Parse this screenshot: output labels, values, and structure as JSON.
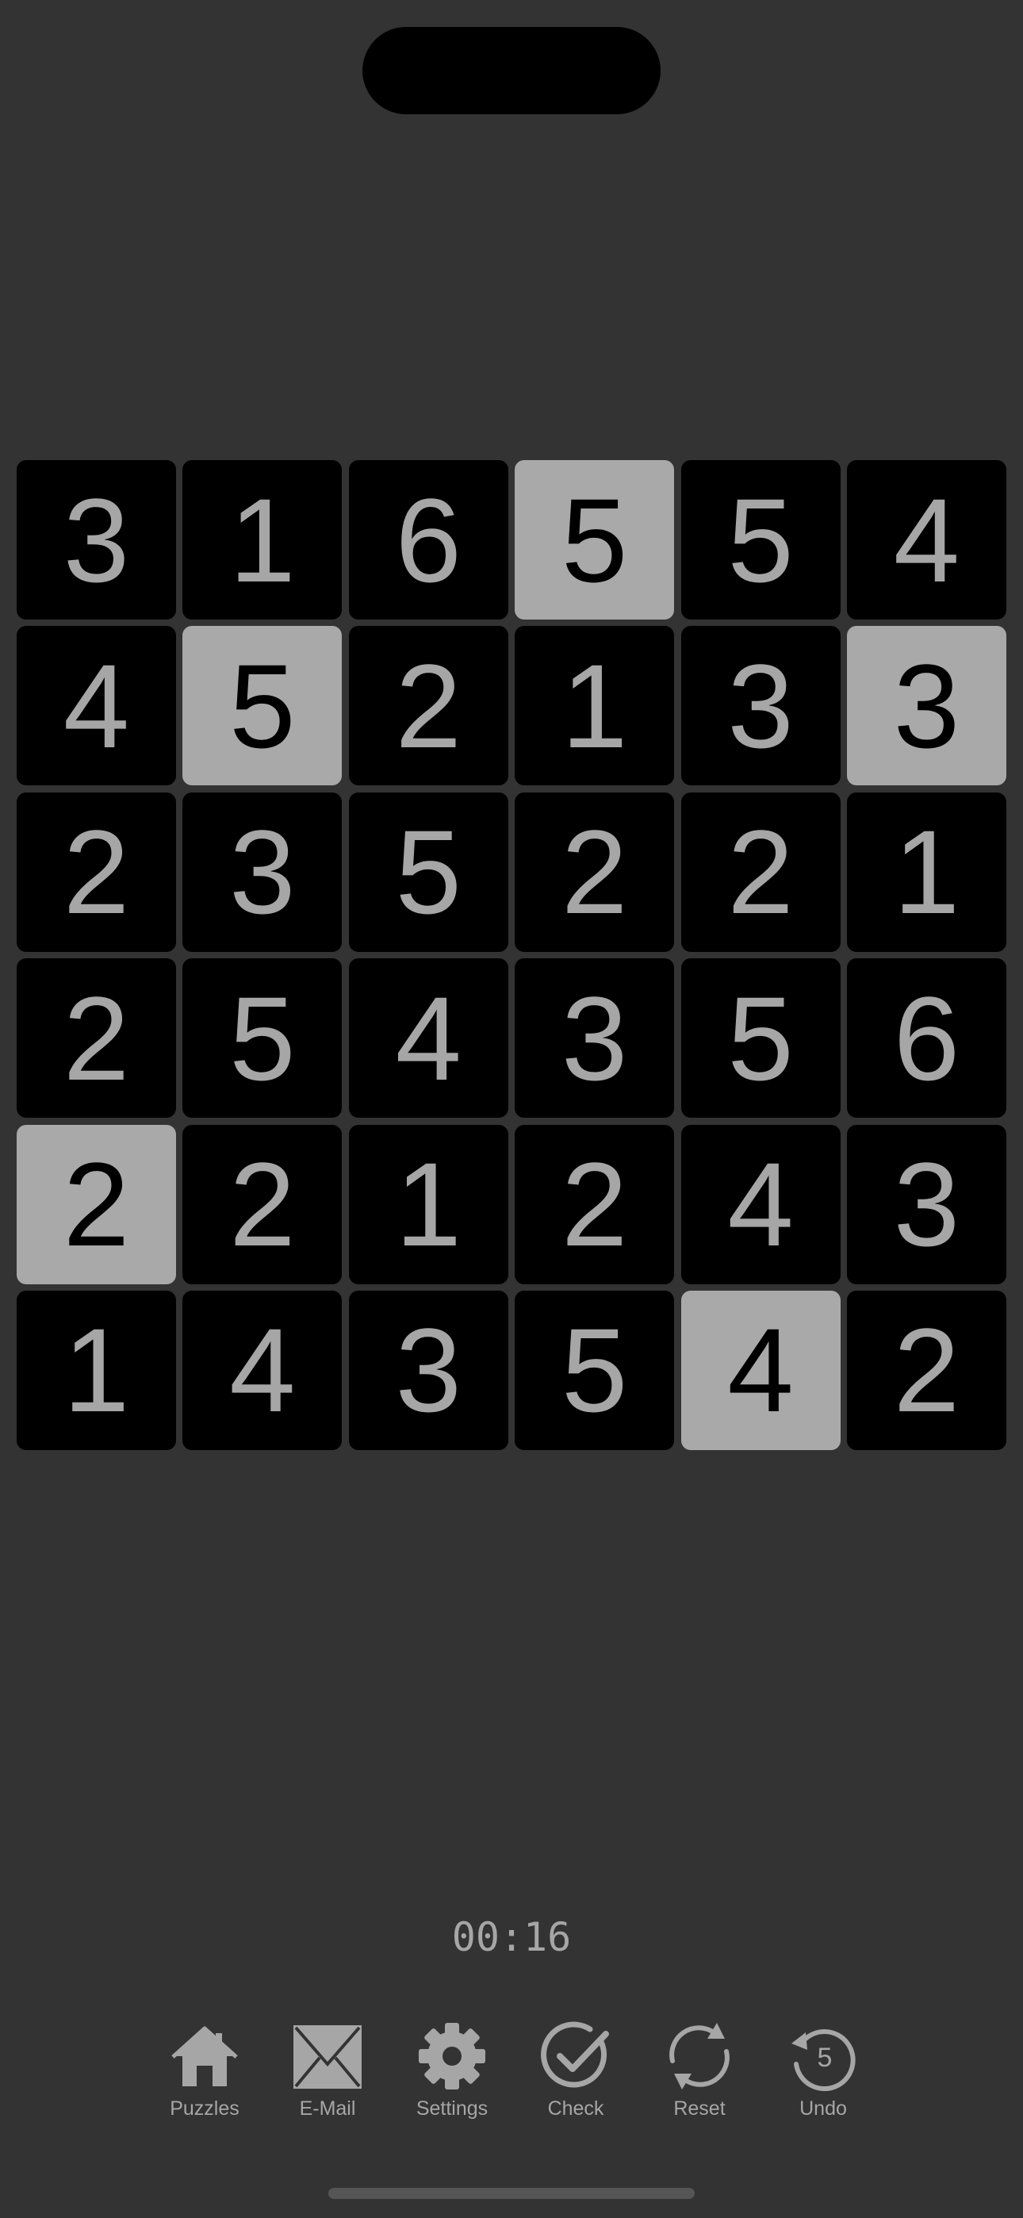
{
  "grid": [
    [
      {
        "v": "3",
        "shaded": false
      },
      {
        "v": "1",
        "shaded": false
      },
      {
        "v": "6",
        "shaded": false
      },
      {
        "v": "5",
        "shaded": true
      },
      {
        "v": "5",
        "shaded": false
      },
      {
        "v": "4",
        "shaded": false
      }
    ],
    [
      {
        "v": "4",
        "shaded": false
      },
      {
        "v": "5",
        "shaded": true
      },
      {
        "v": "2",
        "shaded": false
      },
      {
        "v": "1",
        "shaded": false
      },
      {
        "v": "3",
        "shaded": false
      },
      {
        "v": "3",
        "shaded": true
      }
    ],
    [
      {
        "v": "2",
        "shaded": false
      },
      {
        "v": "3",
        "shaded": false
      },
      {
        "v": "5",
        "shaded": false
      },
      {
        "v": "2",
        "shaded": false
      },
      {
        "v": "2",
        "shaded": false
      },
      {
        "v": "1",
        "shaded": false
      }
    ],
    [
      {
        "v": "2",
        "shaded": false
      },
      {
        "v": "5",
        "shaded": false
      },
      {
        "v": "4",
        "shaded": false
      },
      {
        "v": "3",
        "shaded": false
      },
      {
        "v": "5",
        "shaded": false
      },
      {
        "v": "6",
        "shaded": false
      }
    ],
    [
      {
        "v": "2",
        "shaded": true
      },
      {
        "v": "2",
        "shaded": false
      },
      {
        "v": "1",
        "shaded": false
      },
      {
        "v": "2",
        "shaded": false
      },
      {
        "v": "4",
        "shaded": false
      },
      {
        "v": "3",
        "shaded": false
      }
    ],
    [
      {
        "v": "1",
        "shaded": false
      },
      {
        "v": "4",
        "shaded": false
      },
      {
        "v": "3",
        "shaded": false
      },
      {
        "v": "5",
        "shaded": false
      },
      {
        "v": "4",
        "shaded": true
      },
      {
        "v": "2",
        "shaded": false
      }
    ]
  ],
  "timer": "00:16",
  "toolbar": {
    "puzzles": {
      "label": "Puzzles",
      "icon": "house-icon"
    },
    "email": {
      "label": "E-Mail",
      "icon": "envelope-icon"
    },
    "settings": {
      "label": "Settings",
      "icon": "gear-icon"
    },
    "check": {
      "label": "Check",
      "icon": "checkmark-circle-icon"
    },
    "reset": {
      "label": "Reset",
      "icon": "reset-arrows-icon"
    },
    "undo": {
      "label": "Undo",
      "icon": "undo-arrow-icon",
      "count": "5"
    }
  },
  "colors": {
    "background": "#333333",
    "cell_dark": "#000000",
    "cell_shaded": "#a9a9a9",
    "text_light": "#a6a6a6",
    "text_dark": "#000000"
  }
}
